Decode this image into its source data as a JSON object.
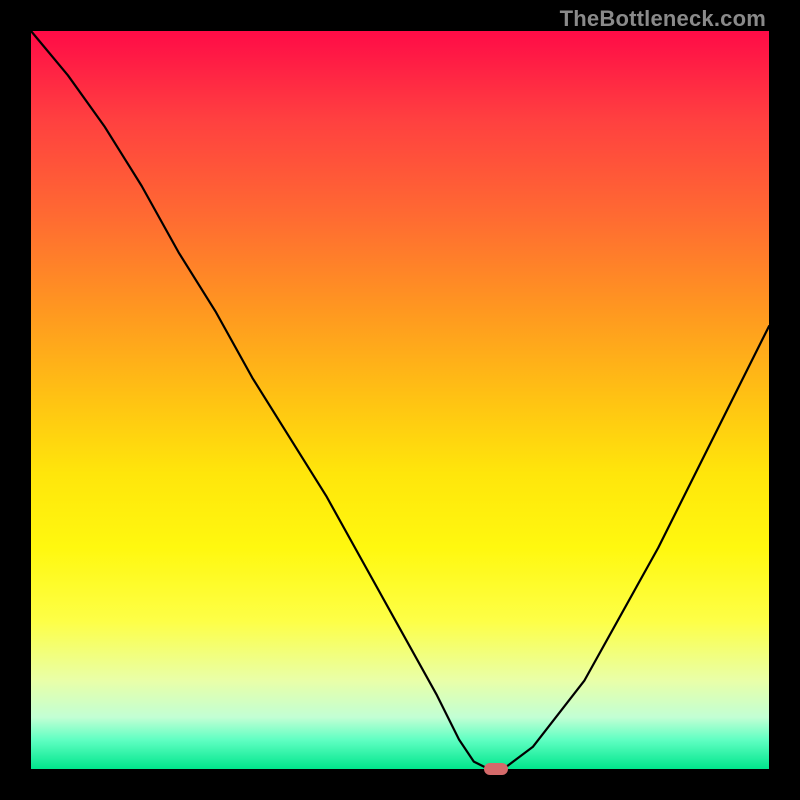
{
  "watermark_text": "TheBottleneck.com",
  "background_color": "#000000",
  "gradient_top": "#ff0b47",
  "gradient_bottom": "#00e68c",
  "curve_color": "#000000",
  "marker_color": "#d46a6a",
  "chart_data": {
    "type": "line",
    "title": "",
    "xlabel": "",
    "ylabel": "",
    "x": [
      0,
      5,
      10,
      15,
      20,
      25,
      30,
      35,
      40,
      45,
      50,
      55,
      58,
      60,
      62,
      64,
      68,
      75,
      85,
      95,
      100
    ],
    "values": [
      100,
      94,
      87,
      79,
      70,
      62,
      53,
      45,
      37,
      28,
      19,
      10,
      4,
      1,
      0,
      0,
      3,
      12,
      30,
      50,
      60
    ],
    "xlim": [
      0,
      100
    ],
    "ylim": [
      0,
      100
    ],
    "optimum_x": 63,
    "optimum_y": 0
  }
}
